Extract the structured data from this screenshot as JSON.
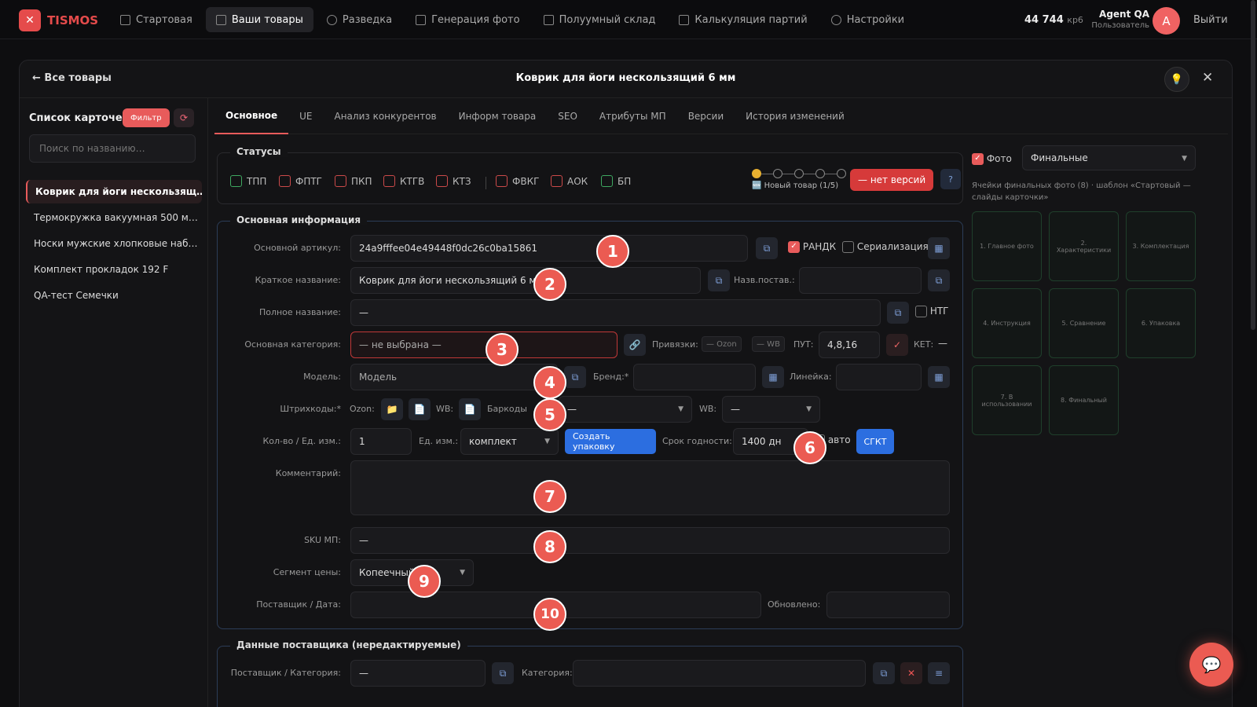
{
  "app": {
    "logo": "TISMOS",
    "balance": "44 744",
    "balance_unit": "кр6",
    "user_name": "Agent QA",
    "user_role": "Пользователь",
    "avatar_letter": "A",
    "logout": "Выйти"
  },
  "nav": [
    "Стартовая",
    "Ваши товары",
    "Разведка",
    "Генерация фото",
    "Полуумный склад",
    "Калькуляция партий",
    "Настройки"
  ],
  "modal": {
    "back": "← Все товары",
    "title": "Коврик для йоги нескользящий 6 мм"
  },
  "sidebar": {
    "title": "Список карточек",
    "filter": "Фильтр",
    "search_placeholder": "Поиск по названию…",
    "items": [
      "Коврик для йоги нескользящ…",
      "Термокружка вакуумная 500 м…",
      "Носки мужские хлопковые наб…",
      "Комплект прокладок 192 F",
      "QA-тест Семечки"
    ]
  },
  "tabs": [
    "Основное",
    "UE",
    "Анализ конкурентов",
    "Информ товара",
    "SEO",
    "Атрибуты МП",
    "Версии",
    "История изменений"
  ],
  "statuses": {
    "title": "Статусы",
    "items": [
      "ТПП",
      "ФПТГ",
      "ПКП",
      "КТГВ",
      "КТЗ",
      "ФВКГ",
      "АОК",
      "БП"
    ],
    "stage": "🆕 Новый товар (1/5)",
    "no_versions": "— нет версий",
    "help": "?"
  },
  "main_info": {
    "title": "Основная информация",
    "article_label": "Основной артикул:",
    "article": "24a9fffee04e49448f0dc26c0ba15861",
    "randk": "РАНДК",
    "serial": "Сериализация",
    "short_label": "Краткое название:",
    "short": "Коврик для йоги нескользящий 6 мм",
    "supplier_name_label": "Назв.постав.:",
    "full_label": "Полное название:",
    "full": "—",
    "ntg": "НТГ",
    "category_label": "Основная категория:",
    "category": "— не выбрана —",
    "bindings_label": "Привязки:",
    "ozon": "— Ozon",
    "wb": "— WB",
    "put_label": "ПУТ:",
    "put": "4,8,16",
    "ket_label": "КЕТ:",
    "ket": "—",
    "model_label": "Модель:",
    "model": "Модель",
    "brand_label": "Бренд:*",
    "line_label": "Линейка:",
    "barcodes_label": "Штрихкоды:*",
    "ozon_short": "Ozon:",
    "wb_short": "WB:",
    "barcodes2_label": "Баркоды",
    "barcode_sel": "—",
    "wb2_label": "WB:",
    "wb_sel": "—",
    "qty_label": "Кол-во / Ед. изм.:",
    "qty": "1",
    "unit_label": "Ед. изм.:",
    "unit": "комплект",
    "create_pack": "Создать упаковку",
    "shelf_label": "Срок годности:",
    "shelf": "1400 дн",
    "auto": "авто",
    "sgkt": "СГКТ",
    "comment_label": "Комментарий:",
    "sku_label": "SKU МП:",
    "sku": "—",
    "segment_label": "Сегмент цены:",
    "segment": "Копеечный",
    "supplier_date_label": "Поставщик / Дата:",
    "updated_label": "Обновлено:"
  },
  "supplier_data": {
    "title": "Данные поставщика (нередактируемые)",
    "supplier_cat_label": "Поставщик / Категория:",
    "supplier": "—",
    "category_label": "Категория:"
  },
  "photos": {
    "label": "Фото",
    "select": "Финальные",
    "caption": "Ячейки финальных фото (8) · шаблон «Стартовый — слайды карточки»",
    "cells": [
      "1. Главное фото",
      "2. Характеристики",
      "3. Комплектация",
      "4. Инструкция",
      "5. Сравнение",
      "6. Упаковка",
      "7. В использовании",
      "8. Финальный"
    ]
  },
  "badges": [
    "1",
    "2",
    "3",
    "4",
    "5",
    "6",
    "7",
    "8",
    "9",
    "10"
  ]
}
